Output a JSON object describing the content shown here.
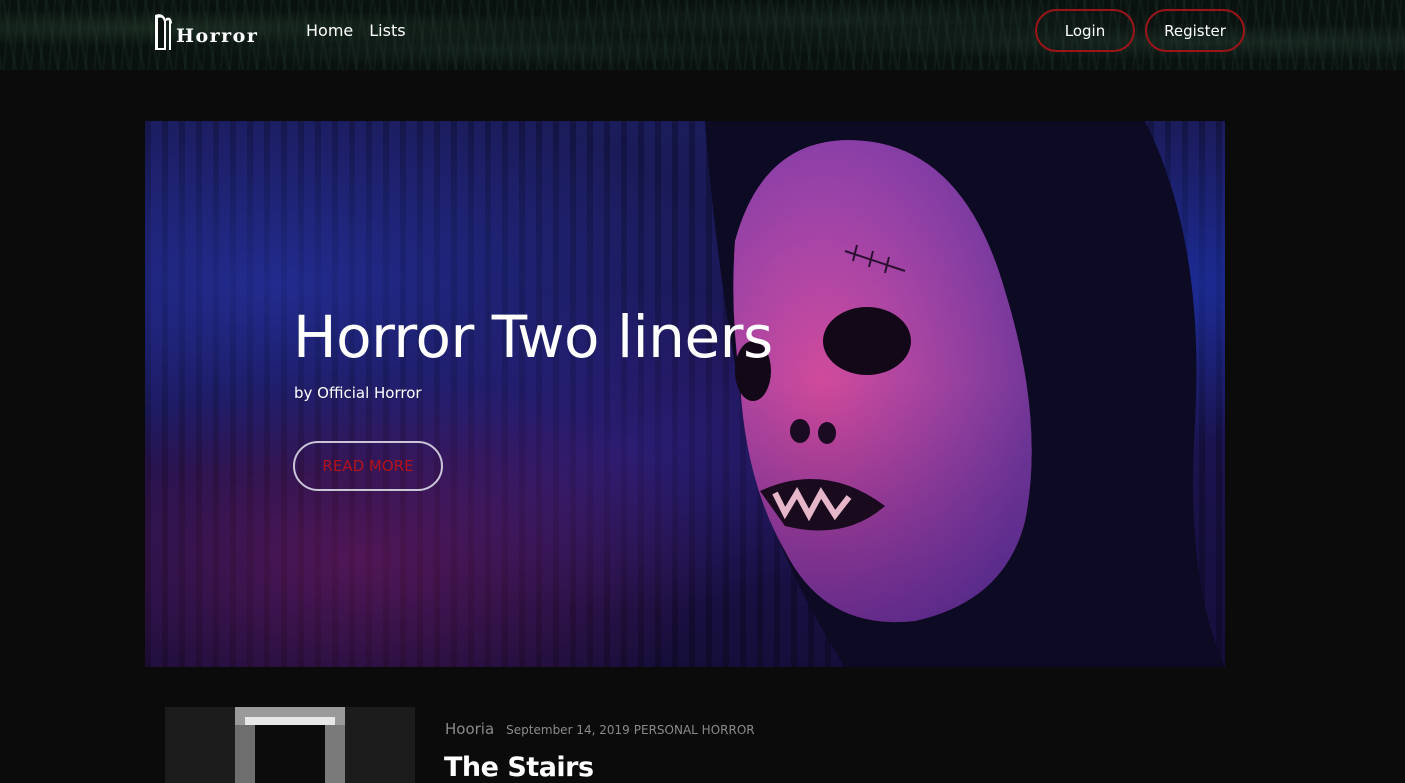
{
  "header": {
    "logo_text": "Horror",
    "nav": [
      {
        "label": "Home"
      },
      {
        "label": "Lists"
      }
    ],
    "login_label": "Login",
    "register_label": "Register"
  },
  "hero": {
    "title": "Horror Two liners",
    "author": "by Official Horror",
    "cta_label": "READ MORE"
  },
  "post": {
    "author": "Hooria",
    "date": "September 14, 2019",
    "category": "PERSONAL HORROR",
    "title": "The Stairs"
  },
  "colors": {
    "background": "#0b0b0b",
    "accent_red": "#9b1418",
    "cta_text": "#b3121b",
    "meta_gray": "#8a8a8a"
  }
}
